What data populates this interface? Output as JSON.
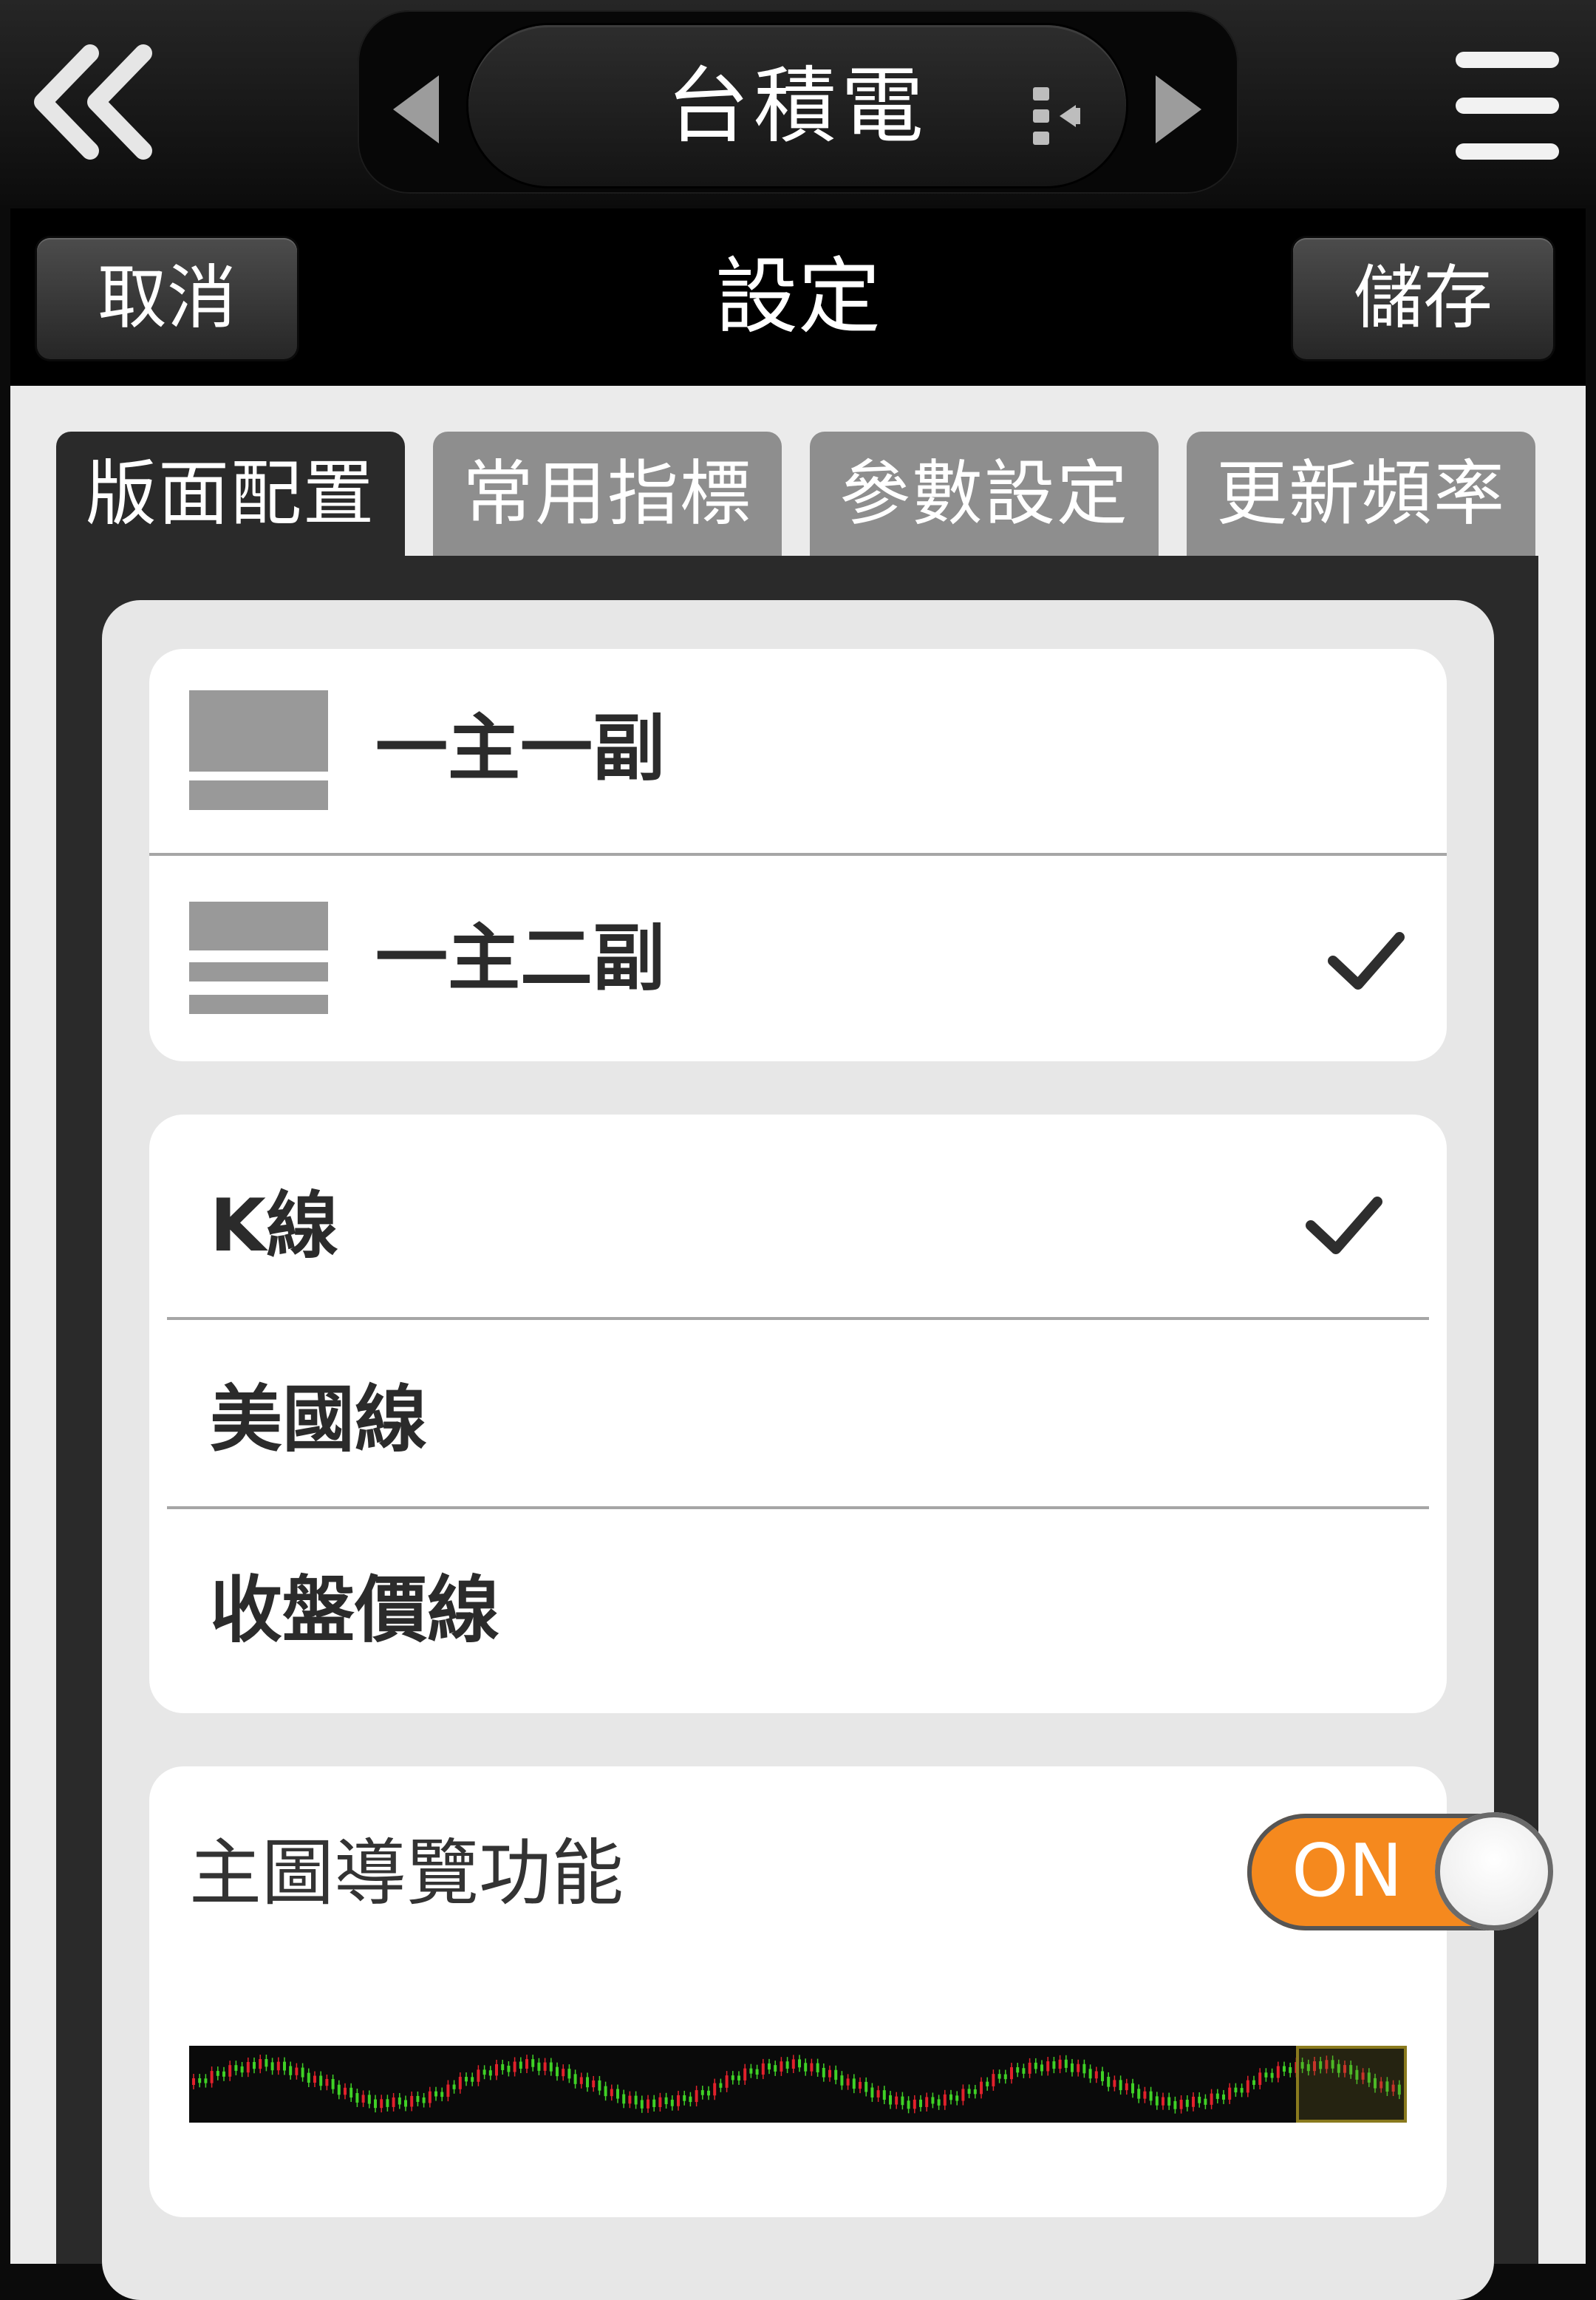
{
  "app_bar": {
    "stock_name": "台積電",
    "back_icon": "double-chevron-left-icon",
    "menu_icon": "hamburger-menu-icon",
    "prev_icon": "triangle-left-icon",
    "next_icon": "triangle-right-icon",
    "switch_icon": "stock-switch-icon"
  },
  "header": {
    "title": "設定",
    "cancel_label": "取消",
    "save_label": "儲存"
  },
  "tabs": [
    {
      "label": "版面配置",
      "active": true
    },
    {
      "label": "常用指標",
      "active": false
    },
    {
      "label": "參數設定",
      "active": false
    },
    {
      "label": "更新頻率",
      "active": false
    }
  ],
  "layout_options": [
    {
      "label": "一主一副",
      "icon": "one-main-one-sub-layout-icon",
      "selected": false
    },
    {
      "label": "一主二副",
      "icon": "one-main-two-sub-layout-icon",
      "selected": true
    }
  ],
  "line_types": [
    {
      "label": "K線",
      "selected": true
    },
    {
      "label": "美國線",
      "selected": false
    },
    {
      "label": "收盤價線",
      "selected": false
    }
  ],
  "navigator": {
    "label": "主圖導覽功能",
    "toggle_text": "ON",
    "enabled": true,
    "strip_name": "chart-navigator-strip"
  },
  "colors": {
    "toggle_on": "#f5891e",
    "candle_up": "#e2212b",
    "candle_down": "#3fd126",
    "navigator_window": "#8a7a1e"
  }
}
